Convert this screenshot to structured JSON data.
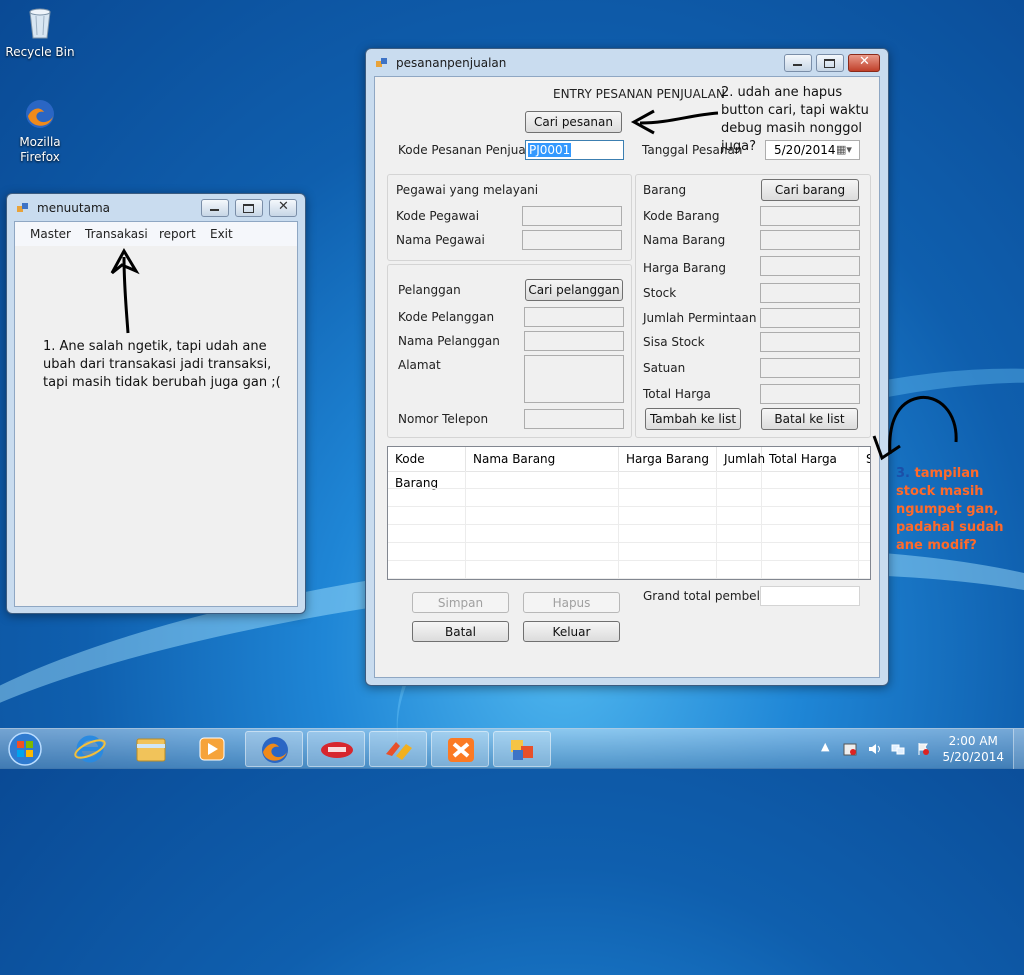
{
  "desktop": {
    "icons": [
      {
        "label": "Recycle Bin"
      },
      {
        "label": "Mozilla Firefox"
      }
    ]
  },
  "menuutama": {
    "title": "menuutama",
    "menu": [
      "Master",
      "Transakasi",
      "report",
      "Exit"
    ]
  },
  "pesanan": {
    "title": "pesananpenjualan",
    "heading": "ENTRY PESANAN PENJUALAN",
    "cari_pesanan": "Cari pesanan",
    "kode_pesanan_label": "Kode Pesanan Penjualan",
    "kode_pesanan_value": "PJ0001",
    "tanggal_label": "Tanggal Pesanan",
    "tanggal_value": "5/20/2014",
    "pegawai": {
      "group": "Pegawai yang melayani",
      "kode": "Kode Pegawai",
      "nama": "Nama Pegawai"
    },
    "pelanggan": {
      "group": "Pelanggan",
      "cari": "Cari pelanggan",
      "kode": "Kode Pelanggan",
      "nama": "Nama Pelanggan",
      "alamat": "Alamat",
      "telepon": "Nomor Telepon"
    },
    "barang": {
      "group": "Barang",
      "cari": "Cari barang",
      "kode": "Kode Barang",
      "nama": "Nama Barang",
      "harga": "Harga Barang",
      "stock": "Stock",
      "jumlah": "Jumlah Permintaan",
      "sisa": "Sisa Stock",
      "satuan": "Satuan",
      "total": "Total Harga",
      "tambah": "Tambah ke list",
      "batal": "Batal ke list"
    },
    "grid_columns": [
      "Kode Barang",
      "Nama Barang",
      "Harga Barang",
      "Jumlah",
      "Total Harga",
      "S"
    ],
    "simpan": "Simpan",
    "hapus": "Hapus",
    "batal": "Batal",
    "keluar": "Keluar",
    "grand_total_label": "Grand total pembelian"
  },
  "annotations": {
    "note1": "1. Ane salah ngetik, tapi udah ane ubah dari transakasi jadi transaksi, tapi masih tidak berubah juga gan ;(",
    "note2": "2. udah ane hapus button cari, tapi waktu debug masih nonggol juga?",
    "note3_num": "3.",
    "note3": "tampilan stock masih ngumpet gan, padahal sudah ane modif?"
  },
  "taskbar": {
    "time": "2:00 AM",
    "date": "5/20/2014",
    "apps": [
      "start-orb",
      "internet-explorer",
      "file-explorer",
      "media-player",
      "firefox",
      "smart-app",
      "app-6",
      "xampp",
      "winforms-app"
    ]
  },
  "colors": {
    "annotation_orange": "#ff6a2a",
    "selected_text_bg": "#3399ff"
  }
}
